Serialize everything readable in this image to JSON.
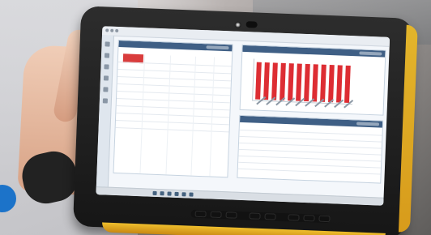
{
  "photo": {
    "device": "rugged-tablet",
    "screen": {
      "title_bar": "",
      "panels": [
        {
          "name": "left-data-panel",
          "header": "",
          "highlighted_cell_color": "#d93c3c"
        },
        {
          "name": "bar-chart-panel",
          "header": "",
          "bar_color": "#dd2d33"
        },
        {
          "name": "lower-right-table-panel",
          "header": ""
        }
      ]
    }
  }
}
